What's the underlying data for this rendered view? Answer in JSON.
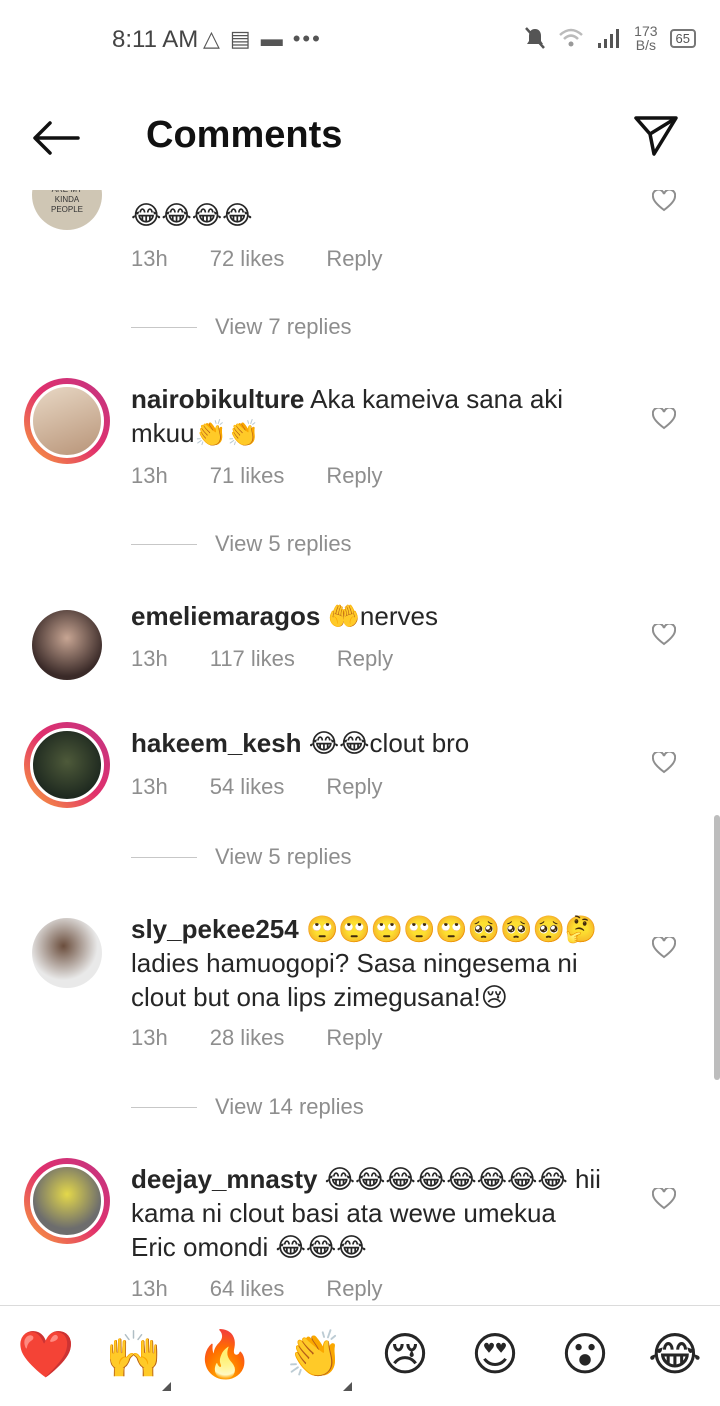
{
  "status": {
    "time": "8:11 AM",
    "left_icons": [
      "△",
      "▤",
      "▬",
      "•••"
    ],
    "speed_value": "173",
    "speed_unit": "B/s",
    "battery": "65"
  },
  "header": {
    "title": "Comments"
  },
  "comments": [
    {
      "user": "",
      "text": "😂😂😂😂",
      "time": "13h",
      "likes": "72 likes",
      "reply": "Reply",
      "view_replies": "View 7 replies"
    },
    {
      "user": "nairobikulture",
      "text": " Aka kameiva sana aki mkuu👏👏",
      "time": "13h",
      "likes": "71 likes",
      "reply": "Reply",
      "view_replies": "View 5 replies"
    },
    {
      "user": "emeliemaragos",
      "text": " 🤲nerves",
      "time": "13h",
      "likes": "117 likes",
      "reply": "Reply"
    },
    {
      "user": "hakeem_kesh",
      "text": " 😂😂clout bro",
      "time": "13h",
      "likes": "54 likes",
      "reply": "Reply",
      "view_replies": "View 5 replies"
    },
    {
      "user": "sly_pekee254",
      "text": " 🙄🙄🙄🙄🙄🥺🥺🥺🤔 ladies hamuogopi? Sasa ningesema ni clout but ona lips zimegusana!😢",
      "time": "13h",
      "likes": "28 likes",
      "reply": "Reply",
      "view_replies": "View 14 replies"
    },
    {
      "user": "deejay_mnasty",
      "text": " 😂😂😂😂😂😂😂😂 hii kama ni clout basi ata wewe umekua Eric omondi 😂😂😂",
      "time": "13h",
      "likes": "64 likes",
      "reply": "Reply"
    }
  ],
  "emoji_bar": [
    "❤️",
    "🙌",
    "🔥",
    "👏",
    "😢",
    "😍",
    "😮",
    "😂"
  ],
  "colors": {
    "ring_start": "#f9a43a",
    "ring_end": "#c13584",
    "meta": "#8e8e8e",
    "heart_red": "#e0202f"
  }
}
